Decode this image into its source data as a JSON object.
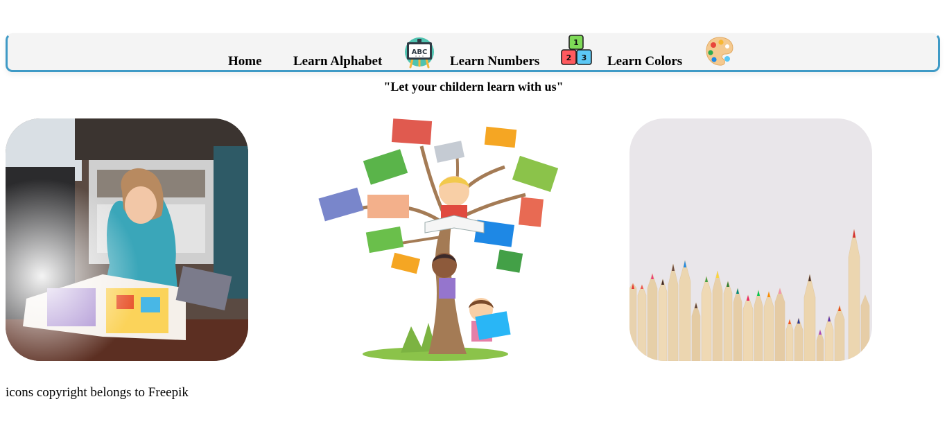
{
  "nav": {
    "items": [
      {
        "label": "Home"
      },
      {
        "label": "Learn Alphabet",
        "icon": "chalkboard-abc-icon",
        "icon_text": "ABC"
      },
      {
        "label": "Learn Numbers",
        "icon": "number-blocks-icon",
        "block_numbers": [
          "1",
          "2",
          "3"
        ]
      },
      {
        "label": "Learn Colors",
        "icon": "paint-palette-icon"
      }
    ]
  },
  "tagline": "\"Let your childern learn with us\"",
  "gallery": [
    {
      "image": "child-reading-picture-book-photo"
    },
    {
      "image": "reading-tree-illustration"
    },
    {
      "image": "colored-pencils-photo"
    }
  ],
  "footer": {
    "text": "icons copyright belongs to Freepik"
  },
  "colors": {
    "nav_border": "#3f9ac6",
    "nav_background": "#f4f4f4",
    "text": "#000000"
  }
}
